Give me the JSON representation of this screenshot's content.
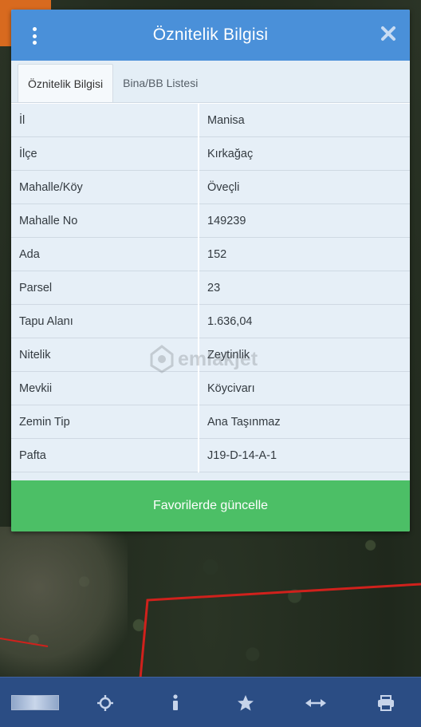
{
  "dialog": {
    "title": "Öznitelik Bilgisi",
    "tabs": [
      {
        "label": "Öznitelik Bilgisi",
        "active": true
      },
      {
        "label": "Bina/BB Listesi",
        "active": false
      }
    ],
    "rows": [
      {
        "key": "İl",
        "value": "Manisa"
      },
      {
        "key": "İlçe",
        "value": "Kırkağaç"
      },
      {
        "key": "Mahalle/Köy",
        "value": "Öveçli"
      },
      {
        "key": "Mahalle No",
        "value": "149239"
      },
      {
        "key": "Ada",
        "value": "152"
      },
      {
        "key": "Parsel",
        "value": "23"
      },
      {
        "key": "Tapu Alanı",
        "value": "1.636,04"
      },
      {
        "key": "Nitelik",
        "value": "Zeytinlik"
      },
      {
        "key": "Mevkii",
        "value": "Köycivarı"
      },
      {
        "key": "Zemin Tip",
        "value": "Ana Taşınmaz"
      },
      {
        "key": "Pafta",
        "value": "J19-D-14-A-1"
      }
    ],
    "favorite_button": "Favorilerde güncelle"
  },
  "watermark": {
    "text": "emlakjet"
  },
  "toolbar": {
    "icons": [
      "tkgm-logo",
      "locate-crosshair-icon",
      "info-icon",
      "star-icon",
      "measure-arrows-icon",
      "print-icon"
    ]
  },
  "colors": {
    "header": "#4a90d9",
    "favorite_button": "#4cbf66",
    "toolbar": "#2b4d84",
    "parcel_border": "#d0211c"
  }
}
